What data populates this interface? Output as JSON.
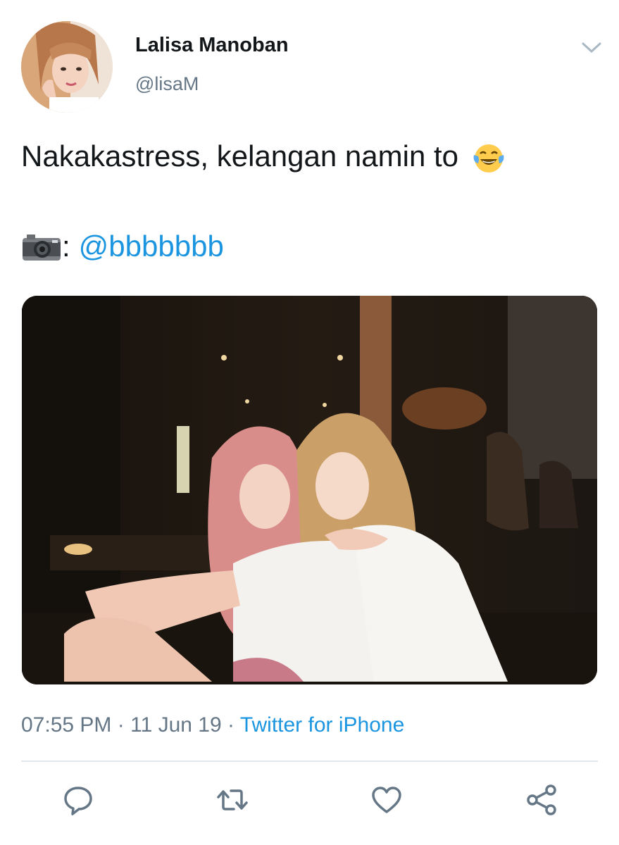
{
  "user": {
    "display_name": "Lalisa Manoban",
    "handle": "@lisaM",
    "avatar_icon": "profile-photo"
  },
  "tweet": {
    "text_line1": "Nakakastress, kelangan namin to",
    "emoji_line1": "face-with-tears-of-joy-emoji",
    "photo_credit_icon": "camera-emoji",
    "photo_credit_separator": ":",
    "mention": "@bbbbbbb"
  },
  "meta": {
    "time": "07:55 PM",
    "separator": "·",
    "date": "11 Jun 19",
    "source": "Twitter for iPhone"
  },
  "actions": {
    "icons": [
      "reply-icon",
      "retweet-icon",
      "like-icon",
      "share-icon"
    ]
  },
  "colors": {
    "text": "#14171a",
    "secondary": "#657786",
    "link": "#1b95e0",
    "divider": "#e1e8ed",
    "icon": "#657786"
  }
}
